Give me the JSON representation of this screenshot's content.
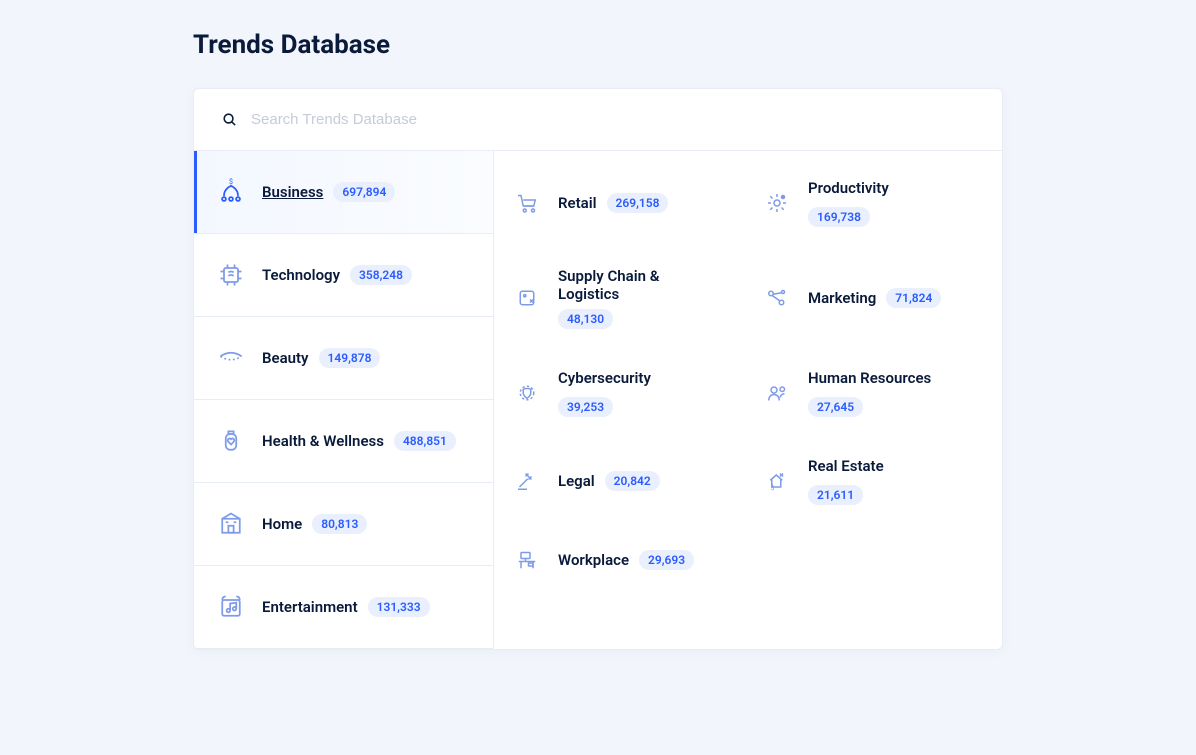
{
  "title": "Trends Database",
  "search": {
    "placeholder": "Search Trends Database"
  },
  "left": [
    {
      "label": "Business",
      "count": "697,894",
      "icon": "business",
      "active": true
    },
    {
      "label": "Technology",
      "count": "358,248",
      "icon": "chip"
    },
    {
      "label": "Beauty",
      "count": "149,878",
      "icon": "eye"
    },
    {
      "label": "Health & Wellness",
      "count": "488,851",
      "icon": "wellness"
    },
    {
      "label": "Home",
      "count": "80,813",
      "icon": "home"
    },
    {
      "label": "Entertainment",
      "count": "131,333",
      "icon": "music"
    }
  ],
  "right": [
    {
      "label": "Retail",
      "count": "269,158",
      "icon": "cart"
    },
    {
      "label": "Productivity",
      "count": "169,738",
      "icon": "gear"
    },
    {
      "label": "Supply Chain & Logistics",
      "count": "48,130",
      "icon": "box",
      "stack": true
    },
    {
      "label": "Marketing",
      "count": "71,824",
      "icon": "share"
    },
    {
      "label": "Cybersecurity",
      "count": "39,253",
      "icon": "shield"
    },
    {
      "label": "Human Resources",
      "count": "27,645",
      "icon": "people"
    },
    {
      "label": "Legal",
      "count": "20,842",
      "icon": "gavel"
    },
    {
      "label": "Real Estate",
      "count": "21,611",
      "icon": "house"
    },
    {
      "label": "Workplace",
      "count": "29,693",
      "icon": "desk"
    }
  ]
}
